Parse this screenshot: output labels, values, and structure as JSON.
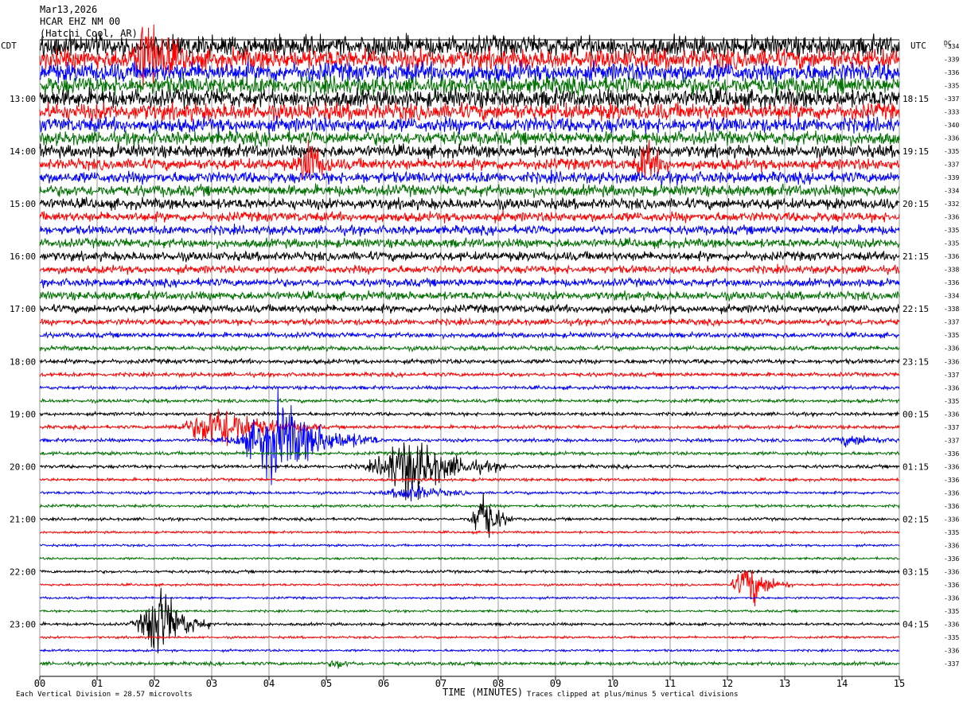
{
  "header": {
    "date": "Mar13,2026",
    "station": "HCAR EHZ NM 00",
    "location": "(Hatchi Cool, AR)"
  },
  "axes": {
    "left_label": "CDT",
    "right_label": "UTC",
    "dc_label": "DC",
    "x_title": "TIME (MINUTES)"
  },
  "footer": {
    "scale_label": "Each Vertical Division =",
    "scale_value": "28.57 microvolts",
    "clip_note": "Traces clipped at plus/minus 5 vertical divisions"
  },
  "colors": {
    "cycle": [
      "#000000",
      "#ff0000",
      "#0000ff",
      "#007000"
    ],
    "grid": "#000000"
  },
  "chart_data": {
    "type": "helicorder",
    "title": "HCAR EHZ NM 00",
    "xlabel": "TIME (MINUTES)",
    "xlim": [
      0,
      15
    ],
    "x_ticks": [
      "00",
      "01",
      "02",
      "03",
      "04",
      "05",
      "06",
      "07",
      "08",
      "09",
      "10",
      "11",
      "12",
      "13",
      "14",
      "15"
    ],
    "lines_per_hour": 4,
    "num_lines": 48,
    "hour_labels_left": [
      {
        "line": 4,
        "label": "13:00"
      },
      {
        "line": 8,
        "label": "14:00"
      },
      {
        "line": 12,
        "label": "15:00"
      },
      {
        "line": 16,
        "label": "16:00"
      },
      {
        "line": 20,
        "label": "17:00"
      },
      {
        "line": 24,
        "label": "18:00"
      },
      {
        "line": 28,
        "label": "19:00"
      },
      {
        "line": 32,
        "label": "20:00"
      },
      {
        "line": 36,
        "label": "21:00"
      },
      {
        "line": 40,
        "label": "22:00"
      },
      {
        "line": 44,
        "label": "23:00"
      }
    ],
    "hour_labels_right": [
      {
        "line": 4,
        "label": "18:15"
      },
      {
        "line": 8,
        "label": "19:15"
      },
      {
        "line": 12,
        "label": "20:15"
      },
      {
        "line": 16,
        "label": "21:15"
      },
      {
        "line": 20,
        "label": "22:15"
      },
      {
        "line": 24,
        "label": "23:15"
      },
      {
        "line": 28,
        "label": "00:15"
      },
      {
        "line": 32,
        "label": "01:15"
      },
      {
        "line": 36,
        "label": "02:15"
      },
      {
        "line": 40,
        "label": "03:15"
      },
      {
        "line": 44,
        "label": "04:15"
      }
    ],
    "dc_offsets": [
      "-334",
      "-339",
      "-336",
      "-335",
      "-337",
      "-333",
      "-340",
      "-336",
      "-335",
      "-337",
      "-339",
      "-334",
      "-332",
      "-336",
      "-335",
      "-335",
      "-336",
      "-338",
      "-336",
      "-334",
      "-338",
      "-337",
      "-335",
      "-336",
      "-336",
      "-337",
      "-336",
      "-335",
      "-336",
      "-337",
      "-337",
      "-336",
      "-336",
      "-336",
      "-336",
      "-336",
      "-336",
      "-335",
      "-336",
      "-336",
      "-336",
      "-336",
      "-336",
      "-335",
      "-336",
      "-335",
      "-336",
      "-337"
    ],
    "noise_levels": [
      1.8,
      1.8,
      1.7,
      1.6,
      1.6,
      1.5,
      1.3,
      1.2,
      1.1,
      1.0,
      1.0,
      1.0,
      0.95,
      0.85,
      0.8,
      0.8,
      0.8,
      0.7,
      0.7,
      0.75,
      0.7,
      0.55,
      0.45,
      0.4,
      0.4,
      0.35,
      0.3,
      0.3,
      0.3,
      0.3,
      0.3,
      0.3,
      0.3,
      0.25,
      0.25,
      0.25,
      0.25,
      0.2,
      0.2,
      0.2,
      0.25,
      0.2,
      0.2,
      0.2,
      0.25,
      0.2,
      0.2,
      0.3
    ],
    "events": [
      {
        "line": 1,
        "minute": 1.9,
        "amplitude": 4.0,
        "duration": 1.0
      },
      {
        "line": 9,
        "minute": 4.7,
        "amplitude": 3.0,
        "duration": 0.6
      },
      {
        "line": 9,
        "minute": 10.6,
        "amplitude": 2.2,
        "duration": 0.6
      },
      {
        "line": 29,
        "minute": 3.2,
        "amplitude": 2.6,
        "duration": 2.3
      },
      {
        "line": 30,
        "minute": 4.2,
        "amplitude": 4.5,
        "duration": 2.3
      },
      {
        "line": 30,
        "minute": 14.2,
        "amplitude": 0.6,
        "duration": 1.2
      },
      {
        "line": 32,
        "minute": 6.5,
        "amplitude": 3.5,
        "duration": 2.2
      },
      {
        "line": 34,
        "minute": 6.5,
        "amplitude": 1.0,
        "duration": 1.4
      },
      {
        "line": 36,
        "minute": 7.75,
        "amplitude": 3.5,
        "duration": 0.7
      },
      {
        "line": 41,
        "minute": 12.4,
        "amplitude": 2.5,
        "duration": 1.0
      },
      {
        "line": 44,
        "minute": 2.1,
        "amplitude": 4.5,
        "duration": 1.2
      },
      {
        "line": 47,
        "minute": 5.2,
        "amplitude": 0.5,
        "duration": 0.5
      }
    ]
  }
}
